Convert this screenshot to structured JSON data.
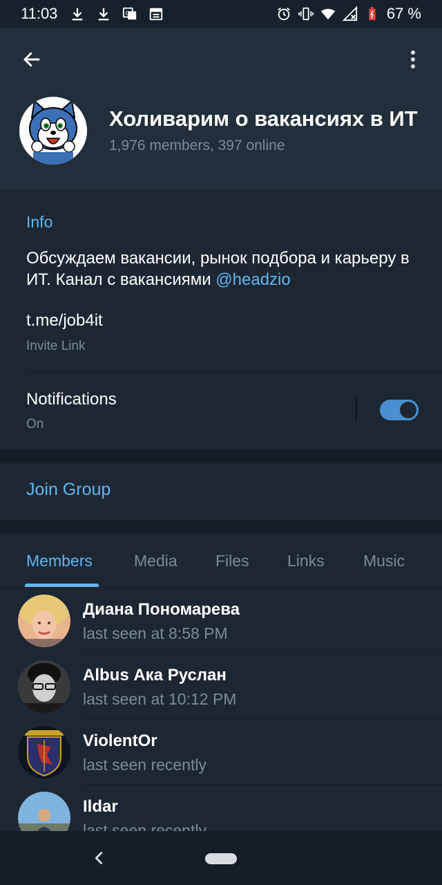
{
  "status_bar": {
    "time": "11:03",
    "battery": "67 %",
    "icons_left": [
      "download-icon",
      "download-icon",
      "translate-icon",
      "calendar-icon"
    ],
    "icons_right": [
      "alarm-icon",
      "vibrate-icon",
      "wifi-icon",
      "signal-icon",
      "battery-icon"
    ]
  },
  "header": {
    "title": "Холиварим о вакансиях в ИТ",
    "subtitle": "1,976 members, 397 online"
  },
  "info": {
    "label": "Info",
    "description": "Обсуждаем вакансии, рынок подбора и карьеру в ИТ. Канал с вакансиями ",
    "mention": "@headzio",
    "link": "t.me/job4it",
    "link_label": "Invite Link",
    "notifications_title": "Notifications",
    "notifications_state": "On",
    "notifications_enabled": true
  },
  "join": {
    "label": "Join Group"
  },
  "tabs": [
    {
      "label": "Members",
      "active": true
    },
    {
      "label": "Media",
      "active": false
    },
    {
      "label": "Files",
      "active": false
    },
    {
      "label": "Links",
      "active": false
    },
    {
      "label": "Music",
      "active": false
    }
  ],
  "members": [
    {
      "name": "Диана Пономарева",
      "status": "last seen at 8:58 PM"
    },
    {
      "name": "Albus Ака Руслан",
      "status": "last seen at 10:12 PM"
    },
    {
      "name": "ViolentOr",
      "status": "last seen recently"
    },
    {
      "name": "Ildar",
      "status": "last seen recently"
    }
  ],
  "colors": {
    "accent": "#64b5ef",
    "background": "#1d2733",
    "header_bg": "#232e3c",
    "secondary_text": "#7d8b99"
  }
}
